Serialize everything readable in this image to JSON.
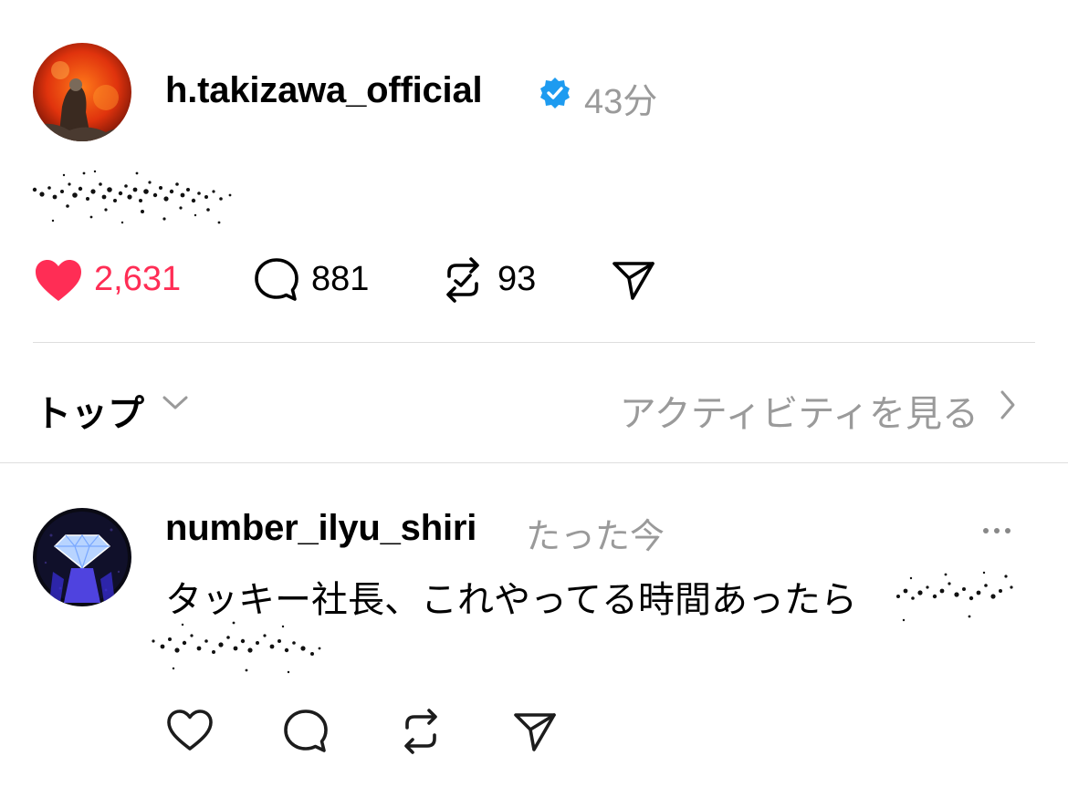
{
  "post": {
    "username": "h.takizawa_official",
    "verified": true,
    "time": "43分",
    "likes": "2,631",
    "comments": "881",
    "reposts": "93",
    "liked": true,
    "accent_color": "#ff2d55",
    "verified_color": "#1d9bf0",
    "icons": [
      "heart-filled-icon",
      "comment-icon",
      "repost-icon",
      "share-icon"
    ]
  },
  "sort": {
    "label": "トップ",
    "activity_link": "アクティビティを見る"
  },
  "reply": {
    "username": "number_ilyu_shiri",
    "time": "たった今",
    "text": "タッキー社長、これやってる時間あったら",
    "icons": [
      "heart-icon",
      "comment-icon",
      "repost-icon",
      "share-icon",
      "more-icon"
    ]
  }
}
